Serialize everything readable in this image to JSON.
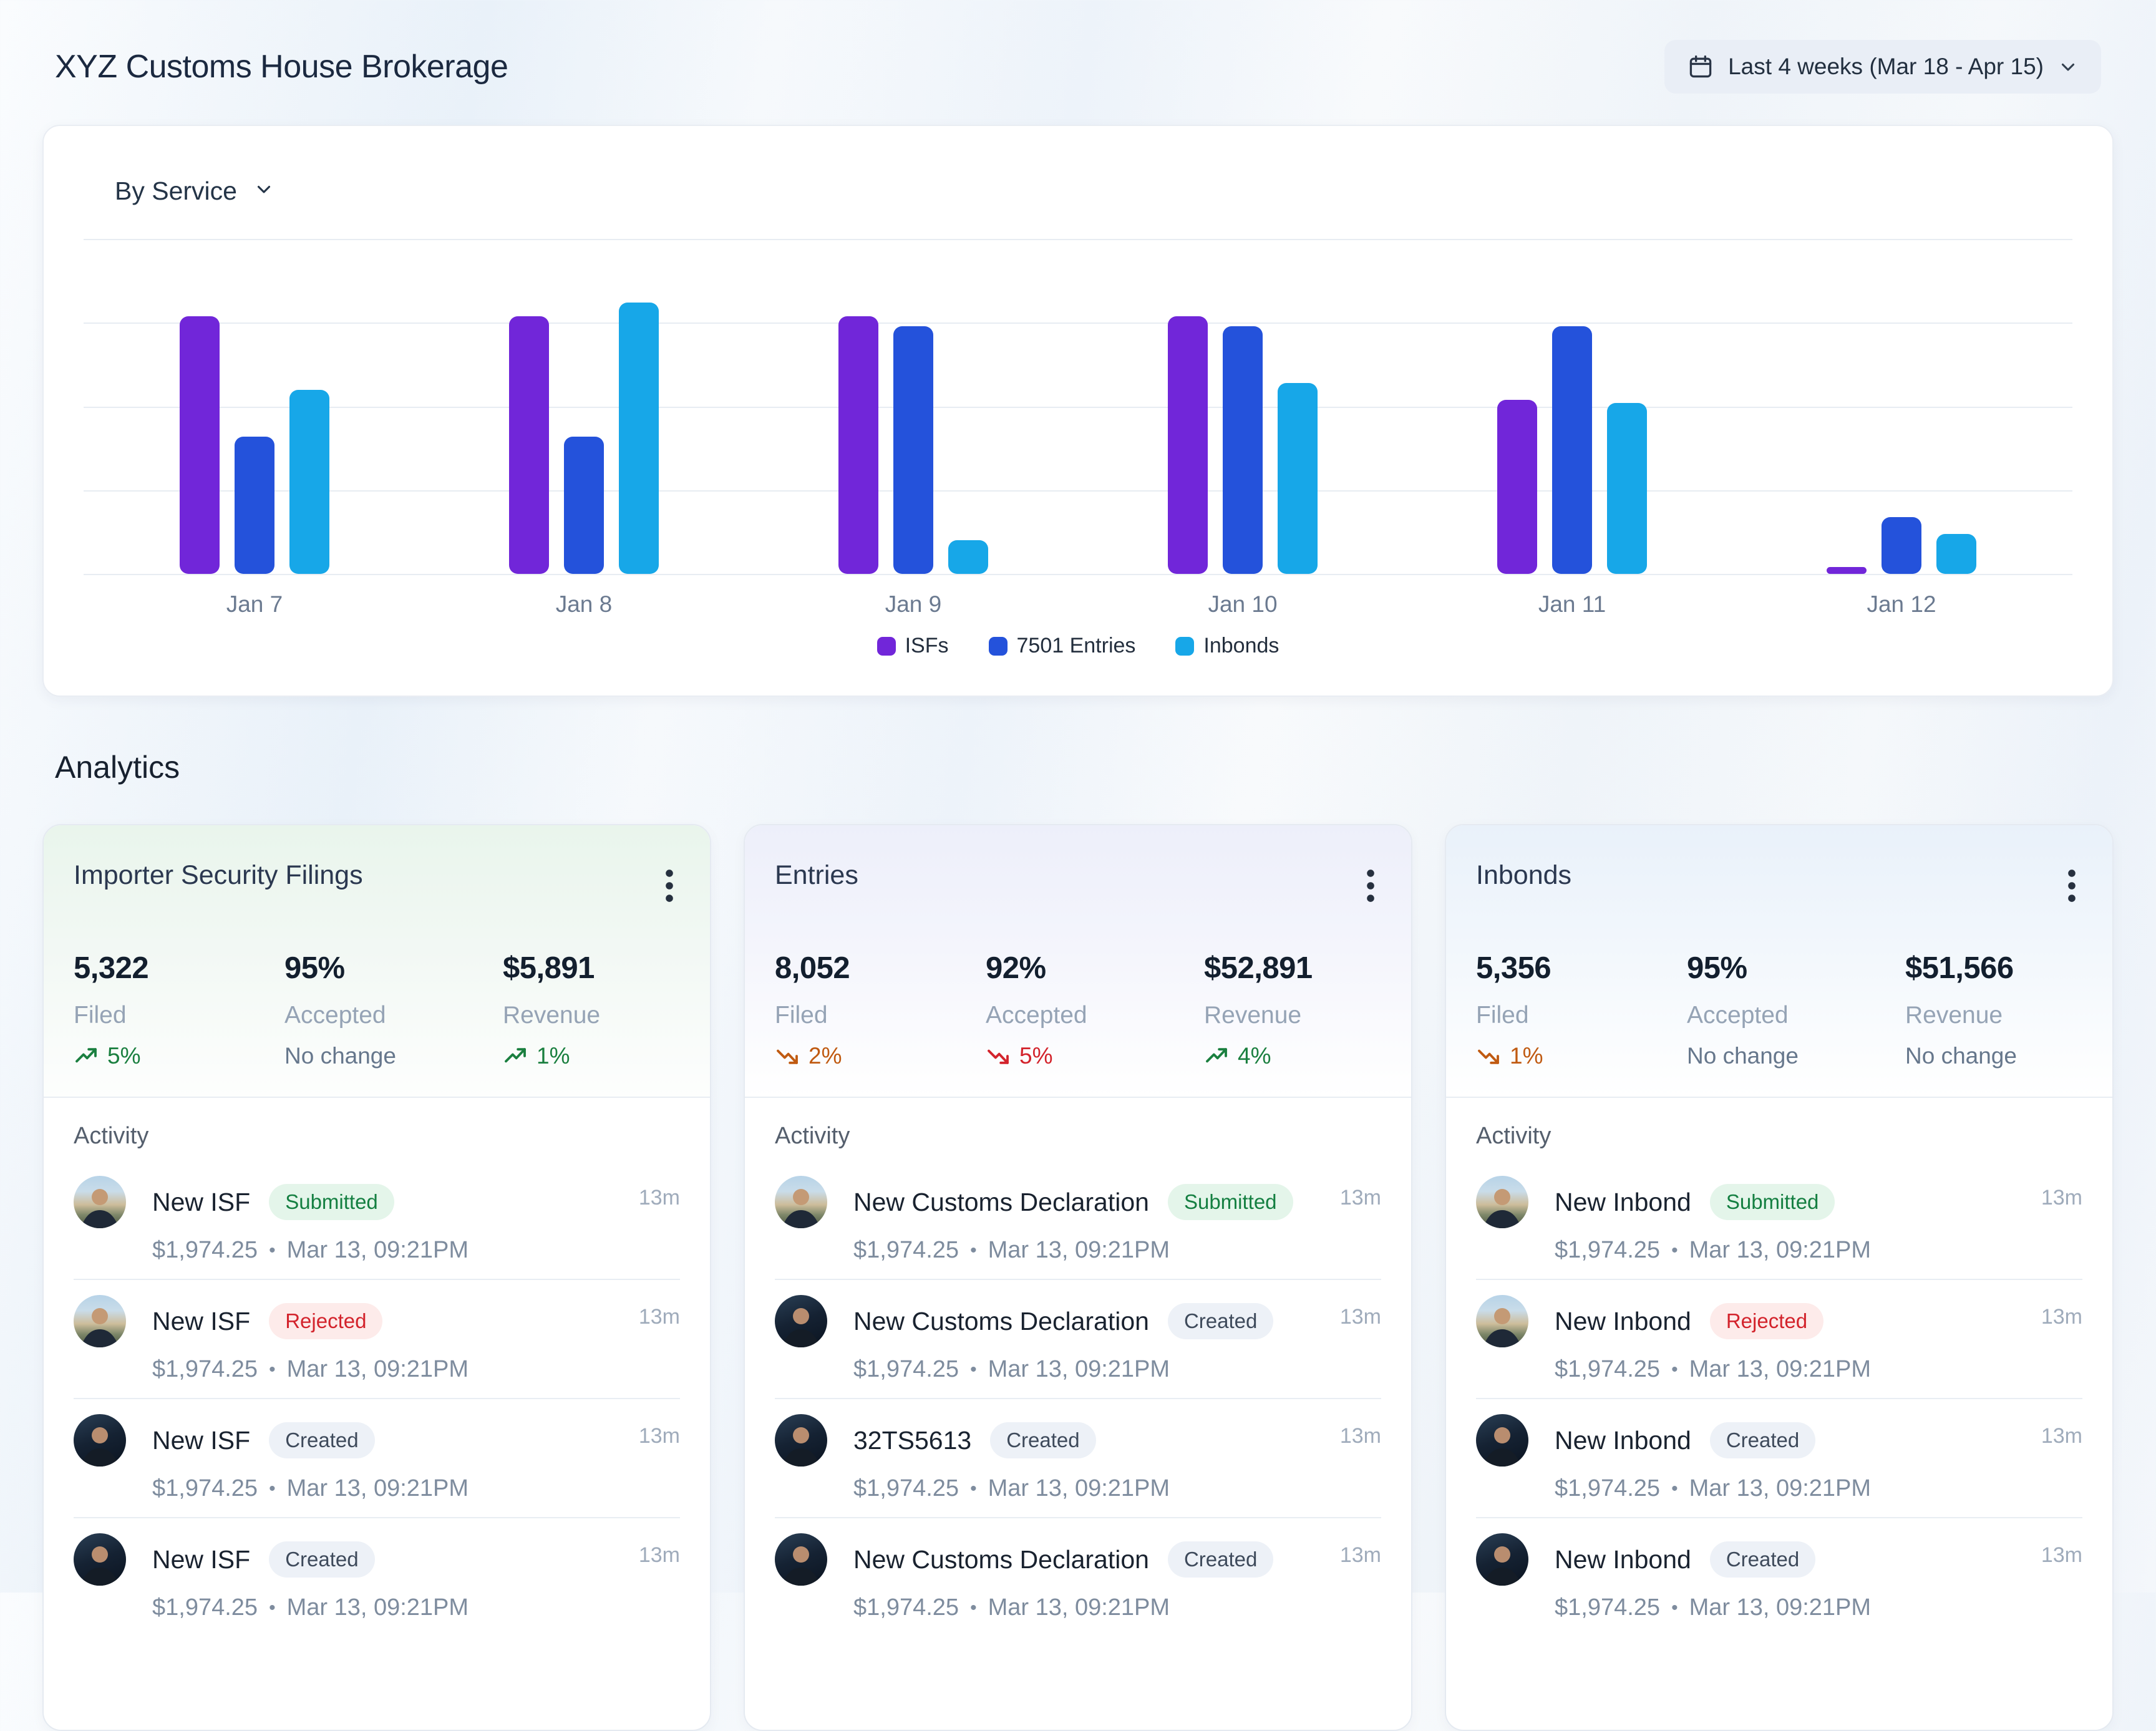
{
  "header": {
    "title": "XYZ Customs House Brokerage",
    "date_filter": {
      "label": "Last 4 weeks (Mar 18 - Apr 15)"
    }
  },
  "chart_card": {
    "filter_label": "By Service"
  },
  "chart_data": {
    "type": "bar",
    "categories": [
      "Jan 7",
      "Jan 8",
      "Jan 9",
      "Jan 10",
      "Jan 11",
      "Jan 12"
    ],
    "series": [
      {
        "name": "ISFs",
        "color": "#7126d9",
        "values": [
          77,
          77,
          77,
          77,
          52,
          2
        ]
      },
      {
        "name": "7501 Entries",
        "color": "#2452db",
        "values": [
          41,
          41,
          74,
          74,
          74,
          17
        ]
      },
      {
        "name": "Inbonds",
        "color": "#17a7e8",
        "values": [
          55,
          81,
          10,
          57,
          51,
          12
        ]
      }
    ],
    "ylim": [
      0,
      100
    ],
    "grid": "horizontal",
    "legend_position": "bottom"
  },
  "analytics": {
    "heading": "Analytics",
    "cards": [
      {
        "title": "Importer Security Filings",
        "accent": "green",
        "stats": [
          {
            "value": "5,322",
            "label": "Filed",
            "trend": "up",
            "change": "5%",
            "color": "#1a7f3f"
          },
          {
            "value": "95%",
            "label": "Accepted",
            "trend": "none",
            "change": "No change",
            "color": "#66778c"
          },
          {
            "value": "$5,891",
            "label": "Revenue",
            "trend": "up",
            "change": "1%",
            "color": "#1a7f3f"
          }
        ],
        "activity_heading": "Activity",
        "activity": [
          {
            "title": "New ISF",
            "badge": "Submitted",
            "badge_kind": "success",
            "time": "13m",
            "amount": "$1,974.25",
            "datetime": "Mar 13, 09:21PM",
            "avatar": "day"
          },
          {
            "title": "New ISF",
            "badge": "Rejected",
            "badge_kind": "danger",
            "time": "13m",
            "amount": "$1,974.25",
            "datetime": "Mar 13, 09:21PM",
            "avatar": "day"
          },
          {
            "title": "New ISF",
            "badge": "Created",
            "badge_kind": "neutral",
            "time": "13m",
            "amount": "$1,974.25",
            "datetime": "Mar 13, 09:21PM",
            "avatar": "night"
          },
          {
            "title": "New ISF",
            "badge": "Created",
            "badge_kind": "neutral",
            "time": "13m",
            "amount": "$1,974.25",
            "datetime": "Mar 13, 09:21PM",
            "avatar": "night"
          }
        ]
      },
      {
        "title": "Entries",
        "accent": "lavender",
        "stats": [
          {
            "value": "8,052",
            "label": "Filed",
            "trend": "down",
            "change": "2%",
            "color": "#c05a11"
          },
          {
            "value": "92%",
            "label": "Accepted",
            "trend": "down",
            "change": "5%",
            "color": "#d3232c"
          },
          {
            "value": "$52,891",
            "label": "Revenue",
            "trend": "up",
            "change": "4%",
            "color": "#1a7f3f"
          }
        ],
        "activity_heading": "Activity",
        "activity": [
          {
            "title": "New Customs Declaration",
            "badge": "Submitted",
            "badge_kind": "success",
            "time": "13m",
            "amount": "$1,974.25",
            "datetime": "Mar 13, 09:21PM",
            "avatar": "day"
          },
          {
            "title": "New Customs Declaration",
            "badge": "Created",
            "badge_kind": "neutral",
            "time": "13m",
            "amount": "$1,974.25",
            "datetime": "Mar 13, 09:21PM",
            "avatar": "night"
          },
          {
            "title": "32TS5613",
            "badge": "Created",
            "badge_kind": "neutral",
            "time": "13m",
            "amount": "$1,974.25",
            "datetime": "Mar 13, 09:21PM",
            "avatar": "night"
          },
          {
            "title": "New Customs Declaration",
            "badge": "Created",
            "badge_kind": "neutral",
            "time": "13m",
            "amount": "$1,974.25",
            "datetime": "Mar 13, 09:21PM",
            "avatar": "night"
          }
        ]
      },
      {
        "title": "Inbonds",
        "accent": "blue",
        "stats": [
          {
            "value": "5,356",
            "label": "Filed",
            "trend": "down",
            "change": "1%",
            "color": "#c05a11"
          },
          {
            "value": "95%",
            "label": "Accepted",
            "trend": "none",
            "change": "No change",
            "color": "#66778c"
          },
          {
            "value": "$51,566",
            "label": "Revenue",
            "trend": "none",
            "change": "No change",
            "color": "#66778c"
          }
        ],
        "activity_heading": "Activity",
        "activity": [
          {
            "title": "New Inbond",
            "badge": "Submitted",
            "badge_kind": "success",
            "time": "13m",
            "amount": "$1,974.25",
            "datetime": "Mar 13, 09:21PM",
            "avatar": "day"
          },
          {
            "title": "New Inbond",
            "badge": "Rejected",
            "badge_kind": "danger",
            "time": "13m",
            "amount": "$1,974.25",
            "datetime": "Mar 13, 09:21PM",
            "avatar": "day"
          },
          {
            "title": "New Inbond",
            "badge": "Created",
            "badge_kind": "neutral",
            "time": "13m",
            "amount": "$1,974.25",
            "datetime": "Mar 13, 09:21PM",
            "avatar": "night"
          },
          {
            "title": "New Inbond",
            "badge": "Created",
            "badge_kind": "neutral",
            "time": "13m",
            "amount": "$1,974.25",
            "datetime": "Mar 13, 09:21PM",
            "avatar": "night"
          }
        ]
      }
    ]
  }
}
